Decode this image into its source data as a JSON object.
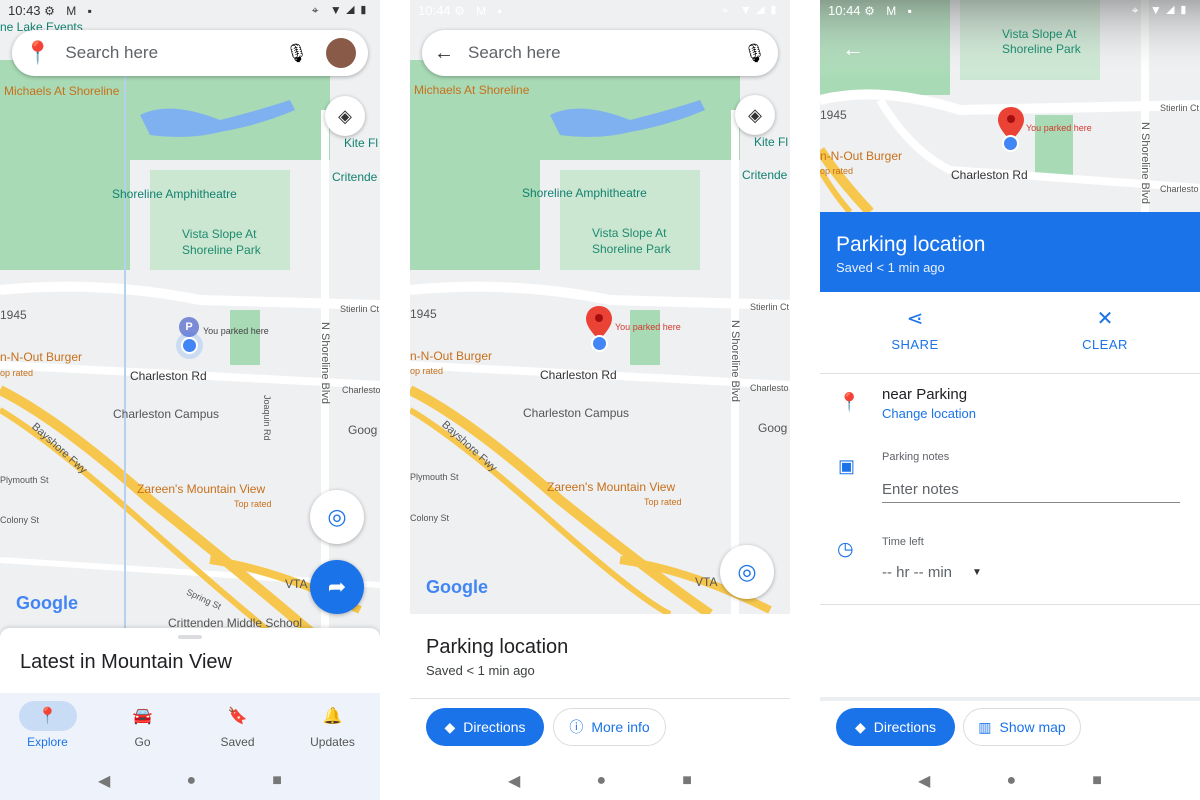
{
  "screen1": {
    "time": "10:43",
    "search_placeholder": "Search here",
    "map_labels": {
      "lake_events": "ne Lake Events",
      "michaels": "Michaels At Shoreline",
      "kite": "Kite Fl",
      "critende": "Critende",
      "amphitheatre": "Shoreline Amphitheatre",
      "vista1": "Vista Slope At",
      "vista2": "Shoreline Park",
      "n1945": "1945",
      "parked": "You parked here",
      "innout": "n-N-Out Burger",
      "toprated": "op rated",
      "charleston_rd": "Charleston Rd",
      "stierlin": "Stierlin Ct",
      "shoreline_blvd": "N Shoreline Blvd",
      "charlesto": "Charlesto",
      "campus": "Charleston Campus",
      "joaquin": "Joaquin Rd",
      "goog": "Goog",
      "bayshore": "Bayshore Fwy",
      "plymouth": "Plymouth St",
      "zareen": "Zareen's Mountain View",
      "zareen_rated": "Top rated",
      "colony": "Colony St",
      "spring": "Spring St",
      "vta": "VTA",
      "crittenden": "Crittenden Middle School",
      "n_shoreline": "N Shoreline",
      "google": "Google",
      "parking_marker": "P"
    },
    "sheet_title": "Latest in Mountain View",
    "nav": [
      {
        "label": "Explore",
        "icon": "pin-icon"
      },
      {
        "label": "Go",
        "icon": "car-icon"
      },
      {
        "label": "Saved",
        "icon": "bookmark-icon"
      },
      {
        "label": "Updates",
        "icon": "bell-icon"
      }
    ]
  },
  "screen2": {
    "time": "10:44",
    "search_placeholder": "Search here",
    "title": "Parking location",
    "subtitle": "Saved < 1 min ago",
    "directions": "Directions",
    "more_info": "More info",
    "google": "Google"
  },
  "screen3": {
    "time": "10:44",
    "title": "Parking location",
    "subtitle": "Saved < 1 min ago",
    "share": "SHARE",
    "clear": "CLEAR",
    "location_name": "near Parking",
    "change_location": "Change location",
    "notes_label": "Parking notes",
    "notes_placeholder": "Enter notes",
    "time_label": "Time left",
    "time_value": "-- hr -- min",
    "directions": "Directions",
    "show_map": "Show map"
  },
  "colors": {
    "accent": "#1a73e8",
    "marker": "#ea4335",
    "park": "#a8dab5",
    "highway": "#f6c74c"
  }
}
